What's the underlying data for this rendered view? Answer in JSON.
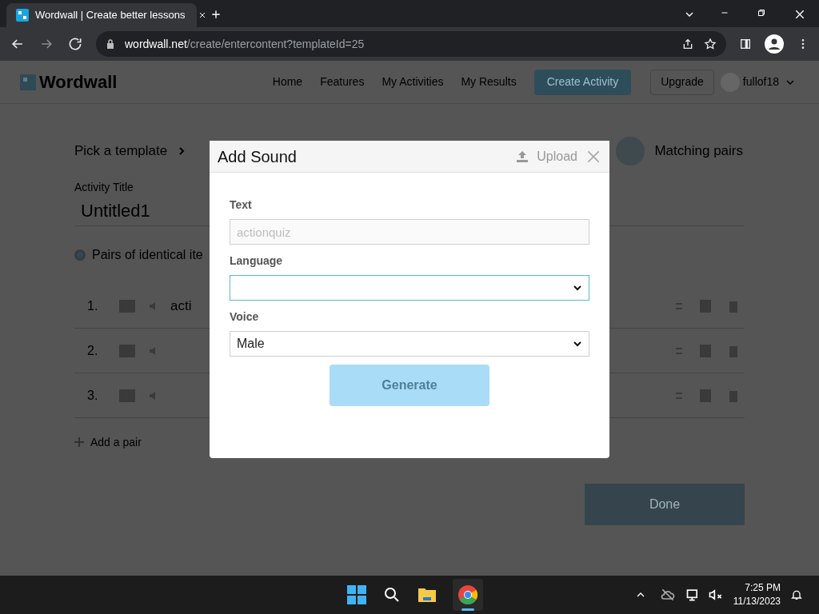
{
  "browser": {
    "tab_title": "Wordwall | Create better lessons",
    "url_domain": "wordwall.net",
    "url_path": "/create/entercontent?templateId=25"
  },
  "site_nav": {
    "logo": "Wordwall",
    "links": [
      "Home",
      "Features",
      "My Activities",
      "My Results"
    ],
    "create_button": "Create Activity",
    "upgrade_button": "Upgrade",
    "user": "fullof18"
  },
  "editor": {
    "breadcrumb": "Pick a template",
    "template_name": "Matching pairs",
    "title_label": "Activity Title",
    "title_value": "Untitled1",
    "option": {
      "label": "Pairs of identical ite",
      "selected": true
    },
    "rows": [
      {
        "number": "1.",
        "text": "acti"
      },
      {
        "number": "2."
      },
      {
        "number": "3."
      }
    ],
    "add_pair": "Add a pair",
    "done_button": "Done"
  },
  "dialog": {
    "title": "Add Sound",
    "upload": "Upload",
    "fields": [
      {
        "kind": "text",
        "label": "Text",
        "placeholder": "actionquiz",
        "focused": false
      },
      {
        "kind": "select",
        "label": "Language",
        "focused": true
      },
      {
        "kind": "select",
        "label": "Voice",
        "value": "Male",
        "focused": false
      }
    ],
    "generate": {
      "label": "Generate",
      "disabled": true
    }
  },
  "taskbar": {
    "time": "7:25 PM",
    "date": "11/13/2023"
  }
}
